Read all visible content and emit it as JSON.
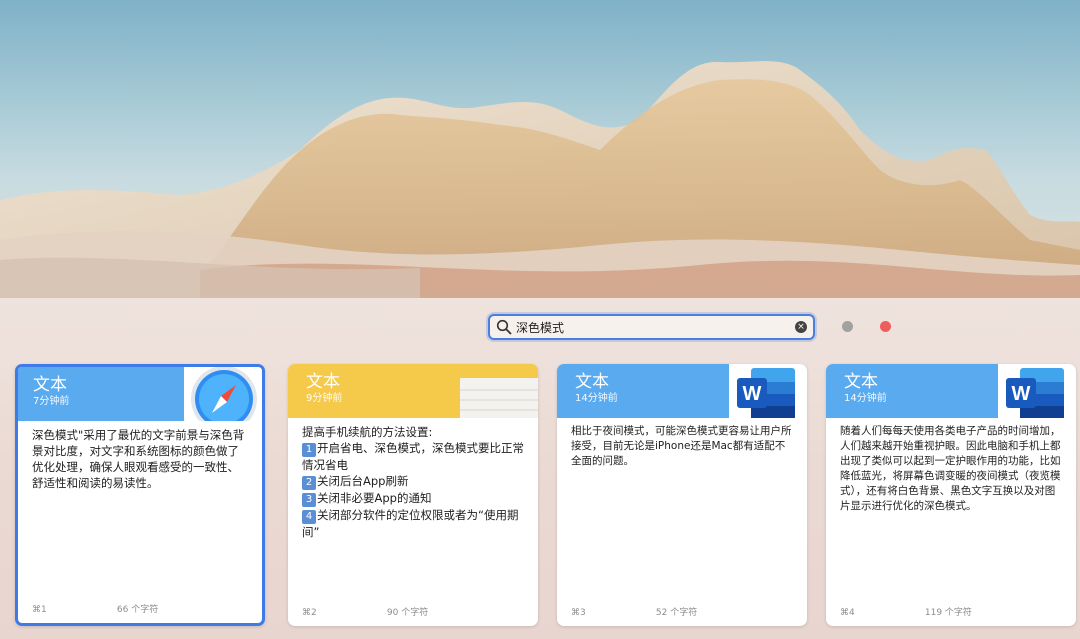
{
  "search": {
    "value": "深色模式",
    "placeholder": ""
  },
  "colors": {
    "blue_header": "#5aaaf0",
    "yellow_header": "#f5c94a",
    "accent": "#3f7be8",
    "close_dot": "#ef5c5c"
  },
  "cards": [
    {
      "type": "文本",
      "time": "7分钟前",
      "app_icon": "safari-icon",
      "text": "深色模式\"采用了最优的文字前景与深色背景对比度，对文字和系统图标的颜色做了优化处理，确保人眼观看感受的一致性、舒适性和阅读的易读性。",
      "shortcut": "⌘1",
      "chars": "66 个字符"
    },
    {
      "type": "文本",
      "time": "9分钟前",
      "app_icon": "notes-icon",
      "intro": "提高手机续航的方法设置:",
      "steps": [
        "开启省电、深色模式，深色模式要比正常情况省电",
        "关闭后台App刷新",
        "关闭非必要App的通知",
        "关闭部分软件的定位权限或者为“使用期间”"
      ],
      "step_nums": [
        "1",
        "2",
        "3",
        "4"
      ],
      "shortcut": "⌘2",
      "chars": "90 个字符"
    },
    {
      "type": "文本",
      "time": "14分钟前",
      "app_icon": "word-icon",
      "text": "相比于夜间模式，可能深色模式更容易让用户所接受，目前无论是iPhone还是Mac都有适配不全面的问题。",
      "shortcut": "⌘3",
      "chars": "52 个字符"
    },
    {
      "type": "文本",
      "time": "14分钟前",
      "app_icon": "word-icon",
      "text": "随着人们每每天使用各类电子产品的时间增加，人们越来越开始重视护眼。因此电脑和手机上都出现了类似可以起到一定护眼作用的功能，比如降低蓝光，将屏幕色调变暖的夜间模式（夜览模式），还有将白色背景、黑色文字互换以及对图片显示进行优化的深色模式。",
      "shortcut": "⌘4",
      "chars": "119 个字符"
    }
  ]
}
